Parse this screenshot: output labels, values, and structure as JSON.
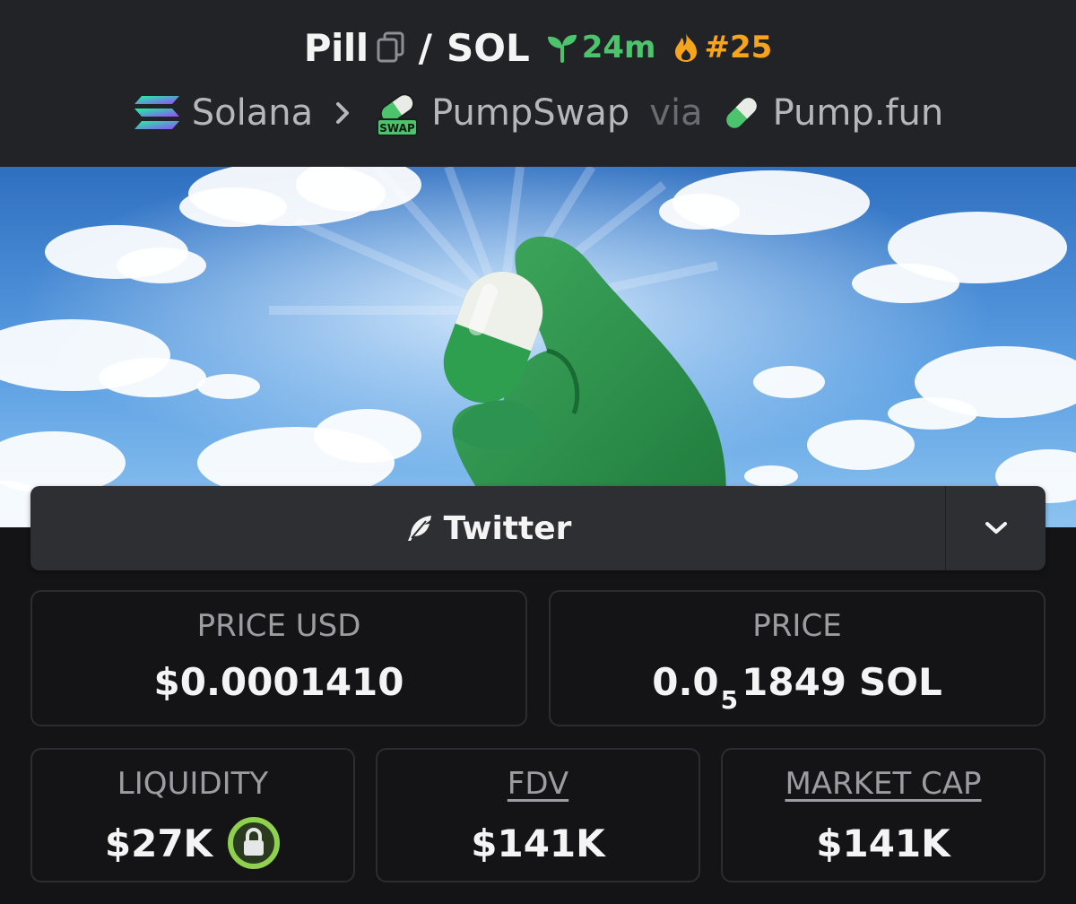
{
  "pair": {
    "base": "Pill",
    "separator": "/",
    "quote": "SOL",
    "age": "24m",
    "rank": "#25"
  },
  "breadcrumb": {
    "chain": "Solana",
    "dex": "PumpSwap",
    "dex_badge": "SWAP",
    "via": "via",
    "launchpad": "Pump.fun"
  },
  "socials": {
    "twitter_label": "Twitter"
  },
  "stats": {
    "price_usd_label": "PRICE USD",
    "price_usd_value": "$0.0001410",
    "price_label": "PRICE",
    "price_prefix": "0.0",
    "price_zeros": "5",
    "price_digits": "1849",
    "price_unit": "SOL",
    "liquidity_label": "LIQUIDITY",
    "liquidity_value": "$27K",
    "fdv_label": "FDV",
    "fdv_value": "$141K",
    "mcap_label": "MARKET CAP",
    "mcap_value": "$141K"
  },
  "colors": {
    "header_bg": "#222326",
    "page_bg": "#141417",
    "age_green": "#4cc46e",
    "rank_orange": "#f6a41c",
    "lock_green": "#8fd14f"
  },
  "icons": {
    "copy": "copy-icon",
    "age": "seedling-icon",
    "rank": "flame-icon",
    "chain": "solana-logo-icon",
    "dex": "pumpswap-logo-icon",
    "launchpad": "pill-icon",
    "twitter": "feather-icon",
    "dropdown": "chevron-down-icon",
    "liquidity": "lock-icon"
  }
}
